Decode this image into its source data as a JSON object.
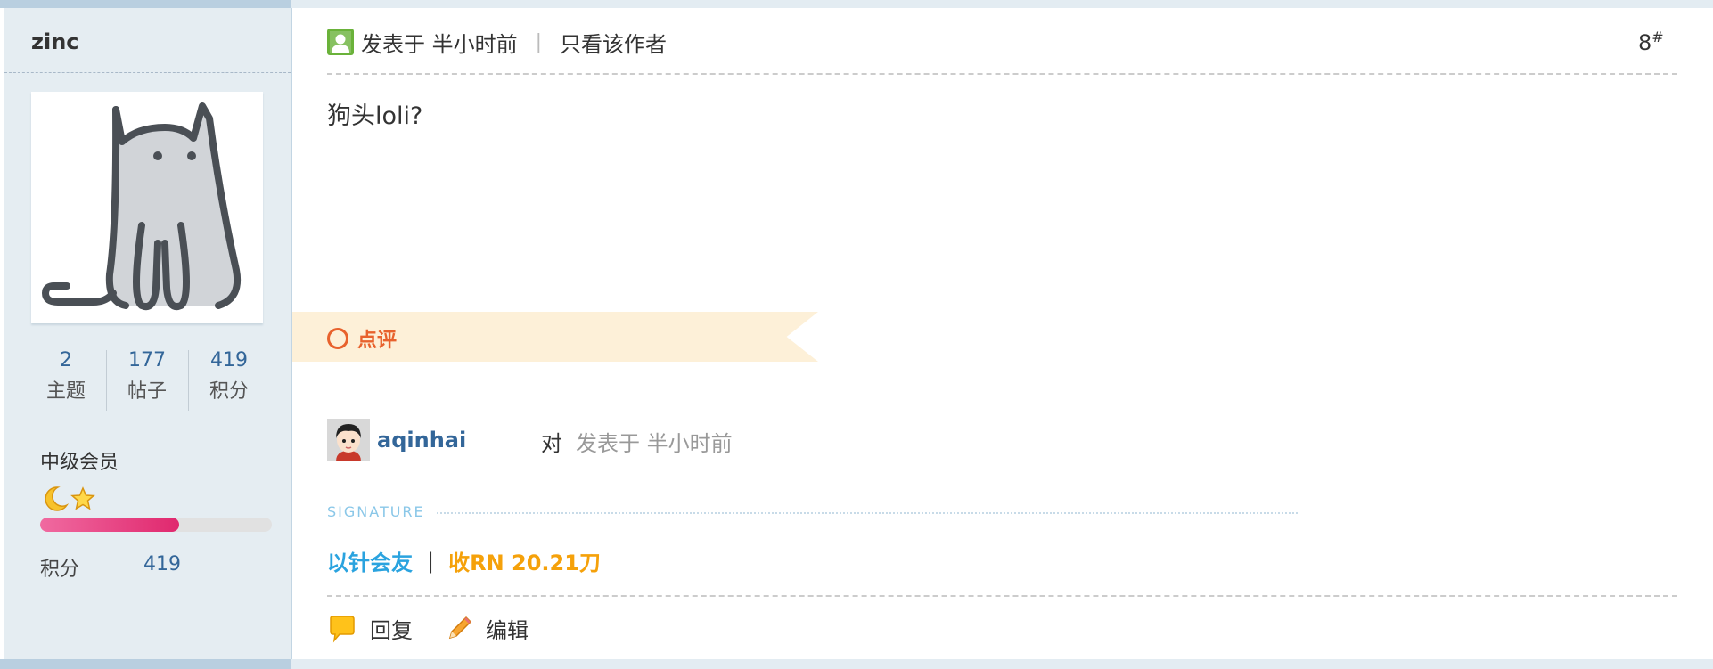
{
  "sidebar": {
    "username": "zinc",
    "stats": [
      {
        "value": "2",
        "label": "主题"
      },
      {
        "value": "177",
        "label": "帖子"
      },
      {
        "value": "419",
        "label": "积分"
      }
    ],
    "level": "中级会员",
    "level_icons": [
      "moon-icon",
      "star-icon"
    ],
    "level_progress": 0.6,
    "points_label": "积分",
    "points_value": "419"
  },
  "post": {
    "posted_label": "发表于 半小时前",
    "only_author": "只看该作者",
    "floor_number": "8",
    "floor_suffix": "#",
    "content": "狗头loli?"
  },
  "comments": {
    "heading": "点评",
    "items": [
      {
        "user": "aqinhai",
        "to": "对",
        "time": "发表于 半小时前"
      }
    ]
  },
  "signature": {
    "label": "SIGNATURE",
    "part1": "以针会友",
    "separator": "|",
    "part2": "收RN 20.21刀"
  },
  "actions": {
    "reply": "回复",
    "edit": "编辑"
  },
  "colors": {
    "accent_link": "#336699",
    "comment_accent": "#e8622d",
    "signature_blue": "#2aa3df",
    "signature_orange": "#f5a10a",
    "progress_pink": "#e0286e"
  }
}
